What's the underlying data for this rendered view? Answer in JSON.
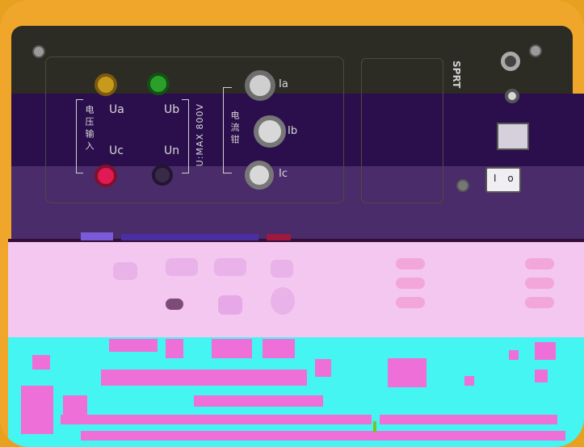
{
  "labels": {
    "ua": "Ua",
    "ub": "Ub",
    "uc": "Uc",
    "un": "Un",
    "ia": "Ia",
    "ib": "Ib",
    "ic": "Ic",
    "voltage_input": "电压输入",
    "umax": "U:MAX 800V",
    "current_clamp": "电流钳",
    "sprt": "SPRT",
    "power_switch": "I o"
  },
  "colors": {
    "case": "#efa62a",
    "panel": "#2c2b24",
    "purple_band": "#2b0f4c",
    "magenta_band": "#f3c7f0",
    "cyan_band": "#45f5f2",
    "socket_yellow": "#c79a1e",
    "socket_green": "#2aa02a",
    "socket_red": "#e01a55",
    "socket_black": "#3a2a4a"
  }
}
